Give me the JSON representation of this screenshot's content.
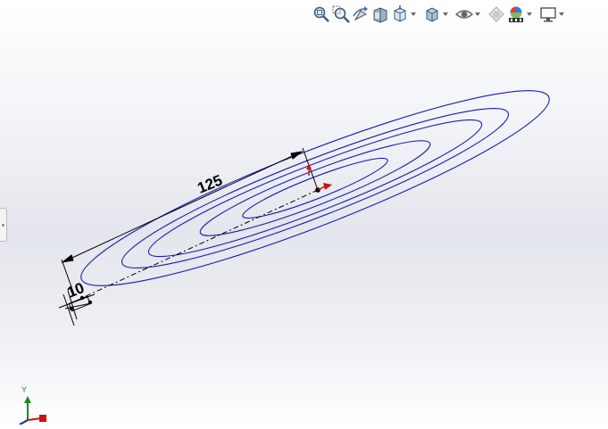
{
  "toolbar": {
    "items": [
      {
        "icon": "zoom-to-fit-icon",
        "dropdown": false
      },
      {
        "icon": "zoom-to-area-icon",
        "dropdown": false
      },
      {
        "icon": "previous-view-icon",
        "dropdown": false
      },
      {
        "icon": "section-view-icon",
        "dropdown": false
      },
      {
        "icon": "view-orientation-icon",
        "dropdown": true
      },
      {
        "icon": "display-style-icon",
        "dropdown": true
      },
      {
        "icon": "hide-show-items-icon",
        "dropdown": true
      },
      {
        "icon": "edit-appearance-icon",
        "dropdown": false
      },
      {
        "icon": "apply-scene-icon",
        "dropdown": true
      },
      {
        "icon": "view-settings-icon",
        "dropdown": true
      }
    ]
  },
  "sketch": {
    "dimensions": {
      "length_label": "125",
      "small_label": "10"
    },
    "curve_color": "#1a1ab8",
    "dimension_color": "#000000",
    "highlight_color": "#cc1111"
  },
  "triad": {
    "y_label": "Y",
    "x_color": "#cc1111",
    "y_color": "#1c8c1c",
    "z_color": "#1a1ab8"
  }
}
